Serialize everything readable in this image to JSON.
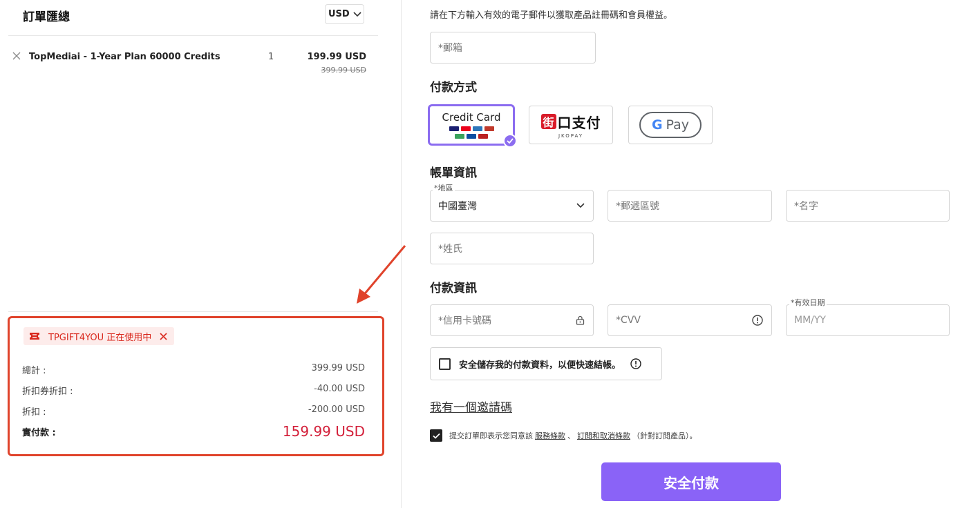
{
  "order": {
    "title": "訂單匯總",
    "currency": "USD"
  },
  "item": {
    "name": "TopMediai - 1-Year Plan 60000 Credits",
    "qty": "1",
    "price": "199.99 USD",
    "old_price": "399.99 USD"
  },
  "summary": {
    "coupon_text": "TPGIFT4YOU 正在使用中",
    "rows": [
      {
        "label": "總計 :",
        "value": "399.99 USD"
      },
      {
        "label": "折扣券折扣 :",
        "value": "-40.00 USD"
      },
      {
        "label": "折扣 :",
        "value": "-200.00 USD"
      }
    ],
    "total_label": "實付款 :",
    "total_value": "159.99 USD"
  },
  "form": {
    "hint": "請在下方輸入有效的電子郵件以獲取產品註冊碼和會員權益。",
    "email_placeholder": "*郵箱",
    "payment_method_title": "付款方式",
    "credit_card_label": "Credit Card",
    "jko_label": "口支付",
    "jko_char": "街",
    "jko_sub": "JKOPAY",
    "gpay_g": "G",
    "gpay_label": "Pay",
    "billing_title": "帳單資訊",
    "region_label": "*地區",
    "region_value": "中國臺灣",
    "postcode_placeholder": "*郵遞區號",
    "firstname_placeholder": "*名字",
    "lastname_placeholder": "*姓氏",
    "payment_info_title": "付款資訊",
    "card_number_placeholder": "*信用卡號碼",
    "cvv_placeholder": "*CVV",
    "expiry_label": "*有效日期",
    "expiry_placeholder": "MM/YY",
    "save_label": "安全儲存我的付款資料，以便快速結帳。",
    "invite_label": "我有一個邀請碼",
    "terms_prefix": "提交訂單即表示您同意該",
    "terms_link1": "服務條款",
    "terms_sep": "、",
    "terms_link2": "訂閱和取消條款",
    "terms_suffix": "（針對訂閱產品）。",
    "submit_label": "安全付款"
  },
  "colors": {
    "accent": "#8a63f7",
    "highlight_border": "#e0432b",
    "total_price": "#d3203a",
    "coupon_text": "#d9281d"
  }
}
